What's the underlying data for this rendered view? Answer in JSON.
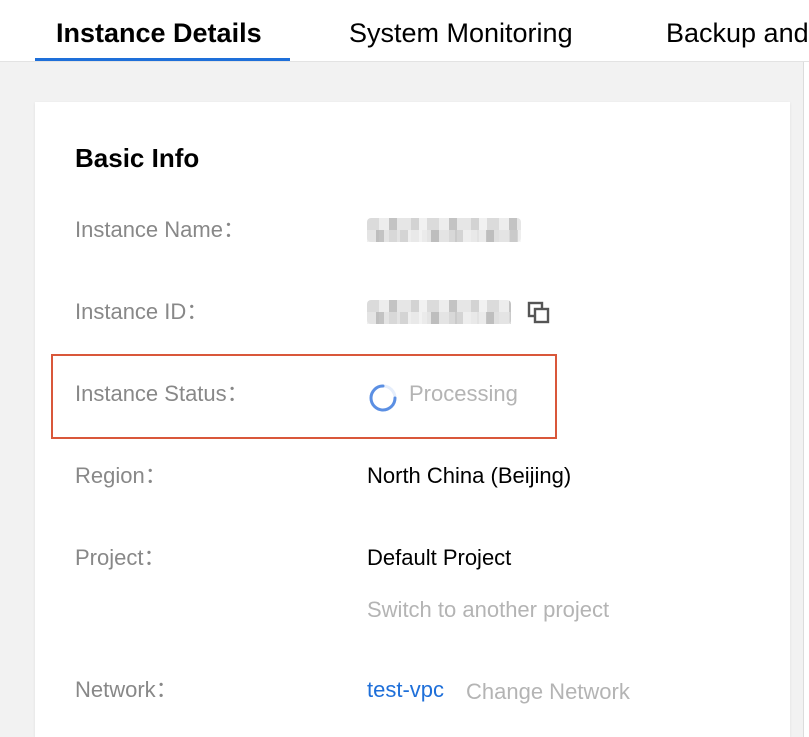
{
  "tabs": [
    {
      "label": "Instance Details",
      "active": true
    },
    {
      "label": "System Monitoring",
      "active": false
    },
    {
      "label": "Backup and"
    }
  ],
  "basic_info": {
    "title": "Basic Info",
    "instance_name": {
      "label": "Instance Name："
    },
    "instance_id": {
      "label": "Instance ID：",
      "copy_icon": "copy-icon"
    },
    "instance_status": {
      "label": "Instance Status：",
      "value": "Processing",
      "icon": "spinner-icon",
      "highlight_color": "#d9573a"
    },
    "region": {
      "label": "Region：",
      "value": "North China (Beijing)"
    },
    "project": {
      "label": "Project：",
      "value": "Default Project",
      "action": "Switch to another project"
    },
    "network": {
      "label": "Network：",
      "value": "test-vpc",
      "action": "Change Network"
    }
  },
  "colors": {
    "accent": "#1e6fd9",
    "highlight": "#d9573a",
    "label": "#888888",
    "muted": "#b4b4b4"
  }
}
